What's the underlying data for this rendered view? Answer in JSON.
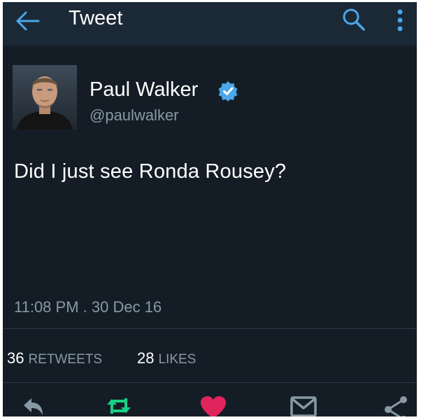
{
  "topbar": {
    "title": "Tweet",
    "back_icon": "arrow-left-icon",
    "search_icon": "search-icon",
    "more_icon": "more-vertical-icon",
    "accent": "#4ca6e8"
  },
  "tweet": {
    "author_name": "Paul Walker",
    "author_handle": "@paulwalker",
    "verified": true,
    "text": "Did I just see Ronda Rousey?",
    "timestamp": "11:08 PM . 30 Dec 16"
  },
  "stats": {
    "retweets_count": "36",
    "retweets_label": "RETWEETS",
    "likes_count": "28",
    "likes_label": "LIKES"
  },
  "actions": [
    {
      "icon": "reply-icon",
      "color": "#8899a6"
    },
    {
      "icon": "retweet-icon",
      "color": "#19cf86"
    },
    {
      "icon": "heart-icon",
      "color": "#e0245e"
    },
    {
      "icon": "message-icon",
      "color": "#8899a6"
    },
    {
      "icon": "share-icon",
      "color": "#8899a6"
    }
  ]
}
